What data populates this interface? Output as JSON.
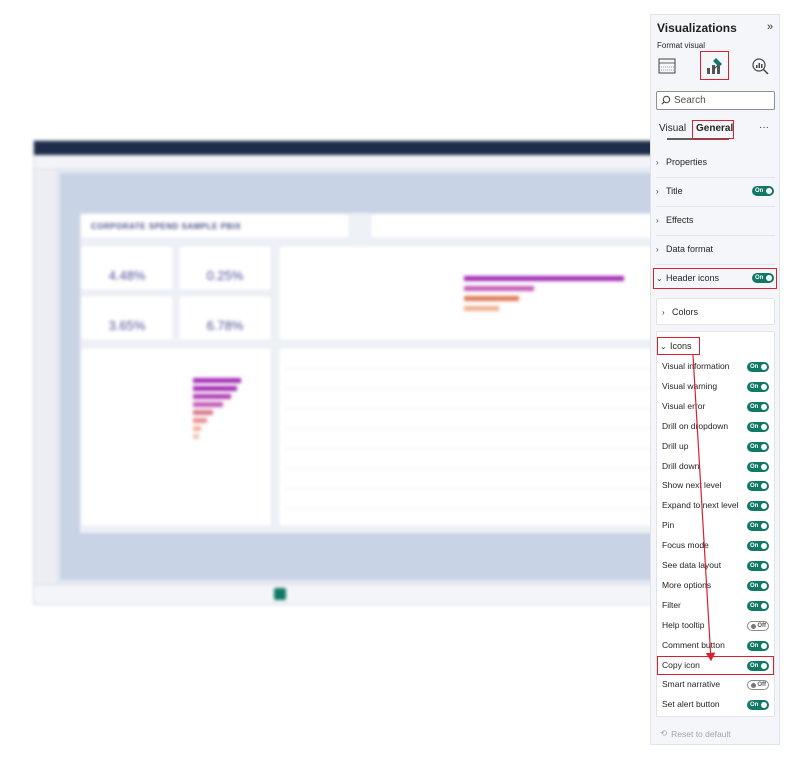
{
  "report": {
    "title": "CORPORATE SPEND SAMPLE PBIX",
    "kpis": [
      "4.48%",
      "0.25%",
      "3.65%",
      "6.78%"
    ]
  },
  "pane": {
    "title": "Visualizations",
    "expand_icon": "chevron-double-right-icon",
    "subtitle": "Format visual",
    "search_placeholder": "Search",
    "tabs": [
      "Visual",
      "General"
    ],
    "more_label": "···",
    "sections": {
      "properties": "Properties",
      "title": "Title",
      "effects": "Effects",
      "data_format": "Data format",
      "header_icons": "Header icons",
      "colors": "Colors",
      "icons": "Icons"
    },
    "toggle_on": "On",
    "toggle_off": "Off",
    "icon_rows": [
      {
        "label": "Visual information",
        "state": "On"
      },
      {
        "label": "Visual warning",
        "state": "On"
      },
      {
        "label": "Visual error",
        "state": "On"
      },
      {
        "label": "Drill on dropdown",
        "state": "On"
      },
      {
        "label": "Drill up",
        "state": "On"
      },
      {
        "label": "Drill down",
        "state": "On"
      },
      {
        "label": "Show next level",
        "state": "On"
      },
      {
        "label": "Expand to next level",
        "state": "On"
      },
      {
        "label": "Pin",
        "state": "On"
      },
      {
        "label": "Focus mode",
        "state": "On"
      },
      {
        "label": "See data layout",
        "state": "On"
      },
      {
        "label": "More options",
        "state": "On"
      },
      {
        "label": "Filter",
        "state": "On"
      },
      {
        "label": "Help tooltip",
        "state": "Off"
      },
      {
        "label": "Comment button",
        "state": "On"
      },
      {
        "label": "Copy icon",
        "state": "On"
      },
      {
        "label": "Smart narrative",
        "state": "Off"
      },
      {
        "label": "Set alert button",
        "state": "On"
      }
    ],
    "reset_label": "Reset to default"
  },
  "colors": {
    "accent_red": "#d8202f",
    "toggle_on": "#117865"
  }
}
